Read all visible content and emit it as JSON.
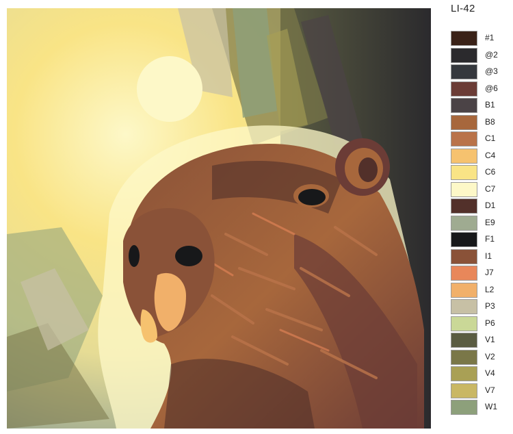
{
  "kit_code": "LI-42",
  "palette": [
    {
      "code": "#1",
      "color": "#3a2218"
    },
    {
      "code": "@2",
      "color": "#2b2a2d"
    },
    {
      "code": "@3",
      "color": "#35383d"
    },
    {
      "code": "@6",
      "color": "#6b3c36"
    },
    {
      "code": "B1",
      "color": "#4b4346"
    },
    {
      "code": "B8",
      "color": "#a7673c"
    },
    {
      "code": "C1",
      "color": "#b9734a"
    },
    {
      "code": "C4",
      "color": "#f6c26f"
    },
    {
      "code": "C6",
      "color": "#f9e486"
    },
    {
      "code": "C7",
      "color": "#fdf8c8"
    },
    {
      "code": "D1",
      "color": "#52302a"
    },
    {
      "code": "E9",
      "color": "#9fab91"
    },
    {
      "code": "F1",
      "color": "#17181a"
    },
    {
      "code": "I1",
      "color": "#8a5238"
    },
    {
      "code": "J7",
      "color": "#e8875a"
    },
    {
      "code": "L2",
      "color": "#f1b06a"
    },
    {
      "code": "P3",
      "color": "#c7c0a5"
    },
    {
      "code": "P6",
      "color": "#cad897"
    },
    {
      "code": "V1",
      "color": "#5a5c42"
    },
    {
      "code": "V2",
      "color": "#7a7748"
    },
    {
      "code": "V4",
      "color": "#a9a055"
    },
    {
      "code": "V7",
      "color": "#c9b764"
    },
    {
      "code": "W1",
      "color": "#8da07b"
    }
  ]
}
